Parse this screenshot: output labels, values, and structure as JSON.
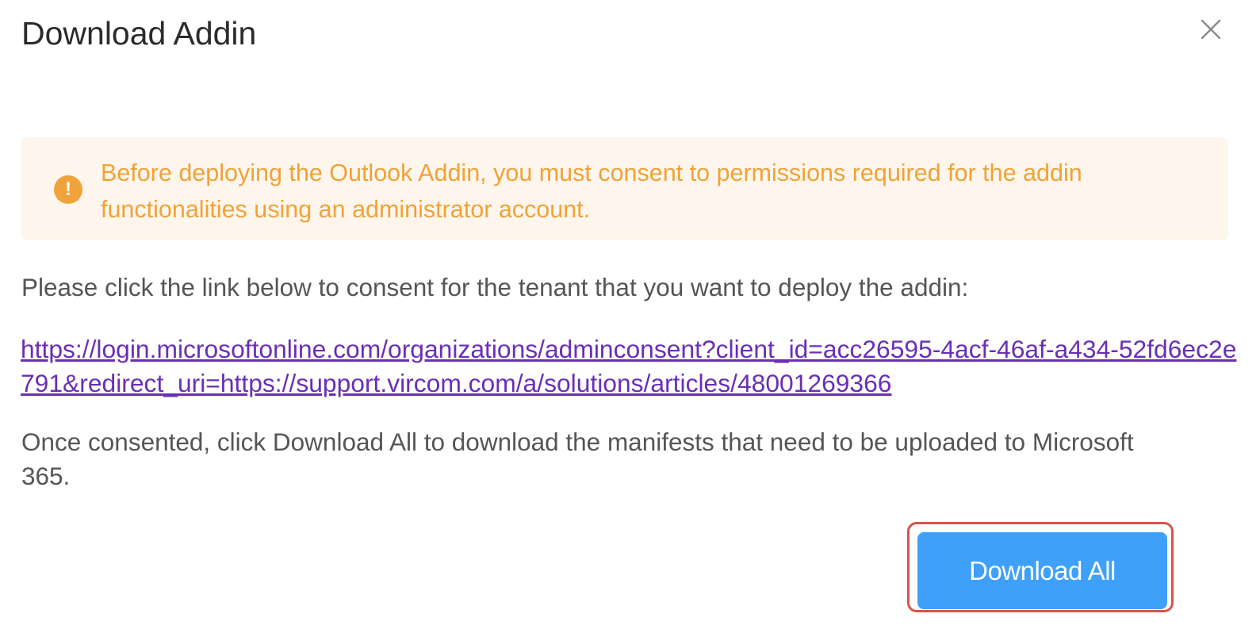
{
  "dialog": {
    "title": "Download Addin",
    "close_icon": "close-icon"
  },
  "alert": {
    "icon": "warning-icon",
    "icon_glyph": "!",
    "text": "Before deploying the Outlook Addin, you must consent to permissions required for the addin functionalities using an administrator account.",
    "color": "#f0a238",
    "background": "#fef6ec"
  },
  "instruction": "Please click the link below to consent for the tenant that you want to deploy the addin:",
  "consent_link": "https://login.microsoftonline.com/organizations/adminconsent?client_id=acc26595-4acf-46af-a434-52fd6ec2e791&redirect_uri=https://support.vircom.com/a/solutions/articles/48001269366",
  "note": "Once consented, click Download All to download the manifests that need to be uploaded to Microsoft 365.",
  "footer": {
    "download_all_label": "Download All",
    "button_color": "#3fa0f9",
    "highlight_color": "#d9534a"
  }
}
